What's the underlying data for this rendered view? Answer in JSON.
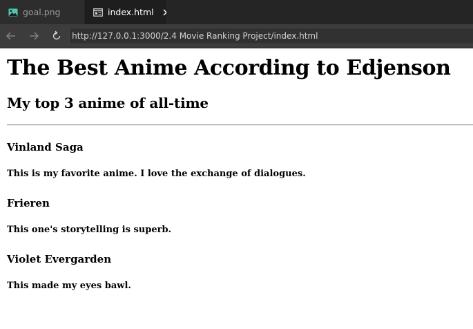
{
  "tabs": [
    {
      "label": "goal.png",
      "icon": "image-icon",
      "active": false
    },
    {
      "label": "index.html",
      "icon": "browser-preview-icon",
      "active": true,
      "close_glyph": "✕"
    }
  ],
  "navbar": {
    "back_icon": "arrow-left-icon",
    "forward_icon": "arrow-right-icon",
    "reload_icon": "reload-icon",
    "url": "http://127.0.0.1:3000/2.4 Movie Ranking Project/index.html"
  },
  "page": {
    "title": "The Best Anime According to Edjenson",
    "subtitle": "My top 3 anime of all-time",
    "items": [
      {
        "name": "Vinland Saga",
        "description": "This is my favorite anime. I love the exchange of dialogues."
      },
      {
        "name": "Frieren",
        "description": "This one's storytelling is superb."
      },
      {
        "name": "Violet Evergarden",
        "description": "This made my eyes bawl."
      }
    ]
  },
  "colors": {
    "tabbar_bg": "#252526",
    "active_tab_bg": "#1e1e1e",
    "navbar_bg": "#3c3c3c",
    "page_bg": "#ffffff",
    "image_icon_accent": "#4ec9b0"
  }
}
